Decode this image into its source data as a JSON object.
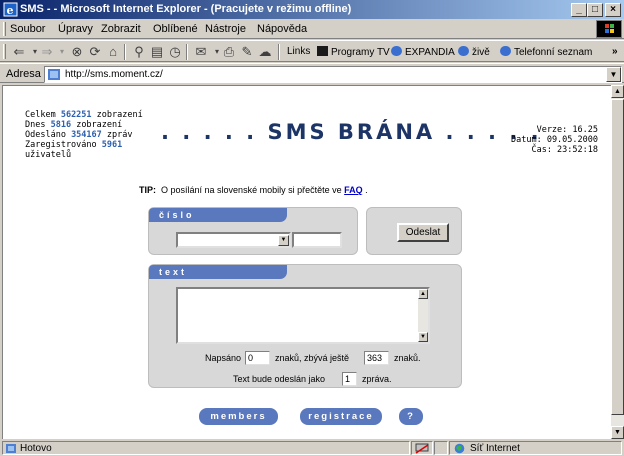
{
  "window": {
    "title": "SMS - - Microsoft Internet Explorer - (Pracujete v režimu offline)",
    "minimize": "_",
    "maximize": "□",
    "close": "×"
  },
  "menu": [
    "Soubor",
    "Úpravy",
    "Zobrazit",
    "Oblíbené",
    "Nástroje",
    "Nápověda"
  ],
  "toolbar": {
    "links_label": "Links",
    "links": [
      "Programy TV",
      "EXPANDIA",
      "živě",
      "Telefonní seznam"
    ],
    "more": "»"
  },
  "address": {
    "label": "Adresa",
    "url": "http://sms.moment.cz/"
  },
  "stats": {
    "line1_prefix": "Celkem ",
    "total_views": "562251",
    "line1_suffix": " zobrazení",
    "line2_prefix": "Dnes ",
    "today_views": "5816",
    "line2_suffix": " zobrazení",
    "line3_prefix": "Odesláno ",
    "sent": "354167",
    "line3_suffix": " zpráv",
    "line4_prefix": "Zaregistrováno ",
    "registered": "5961",
    "line5": "uživatelů"
  },
  "brand": ". . . . . SMS BRÁNA . . . . .",
  "version": {
    "line1": "Verze: 16.25",
    "line2": "Datum: 09.05.2000",
    "line3": "Čas: 23:52:18"
  },
  "tip": {
    "label": "TIP:",
    "text": "O posílání na slovenské mobily si přečtěte ve",
    "link": "FAQ",
    "end": "."
  },
  "number_panel": {
    "tab": "číslo",
    "prefix_value": "",
    "number_value": ""
  },
  "send_button": "Odeslat",
  "text_panel": {
    "tab": "text",
    "message_value": "",
    "written_label": "Napsáno",
    "written_value": "0",
    "remaining_label": "znaků, zbývá ještě",
    "remaining_value": "363",
    "remaining_suffix": "znaků.",
    "parts_label": "Text bude odeslán jako",
    "parts_value": "1",
    "parts_suffix": "zpráva."
  },
  "nav_buttons": [
    "members",
    "registrace",
    "?"
  ],
  "status": {
    "text": "Hotovo",
    "zone": "Síť Internet"
  }
}
